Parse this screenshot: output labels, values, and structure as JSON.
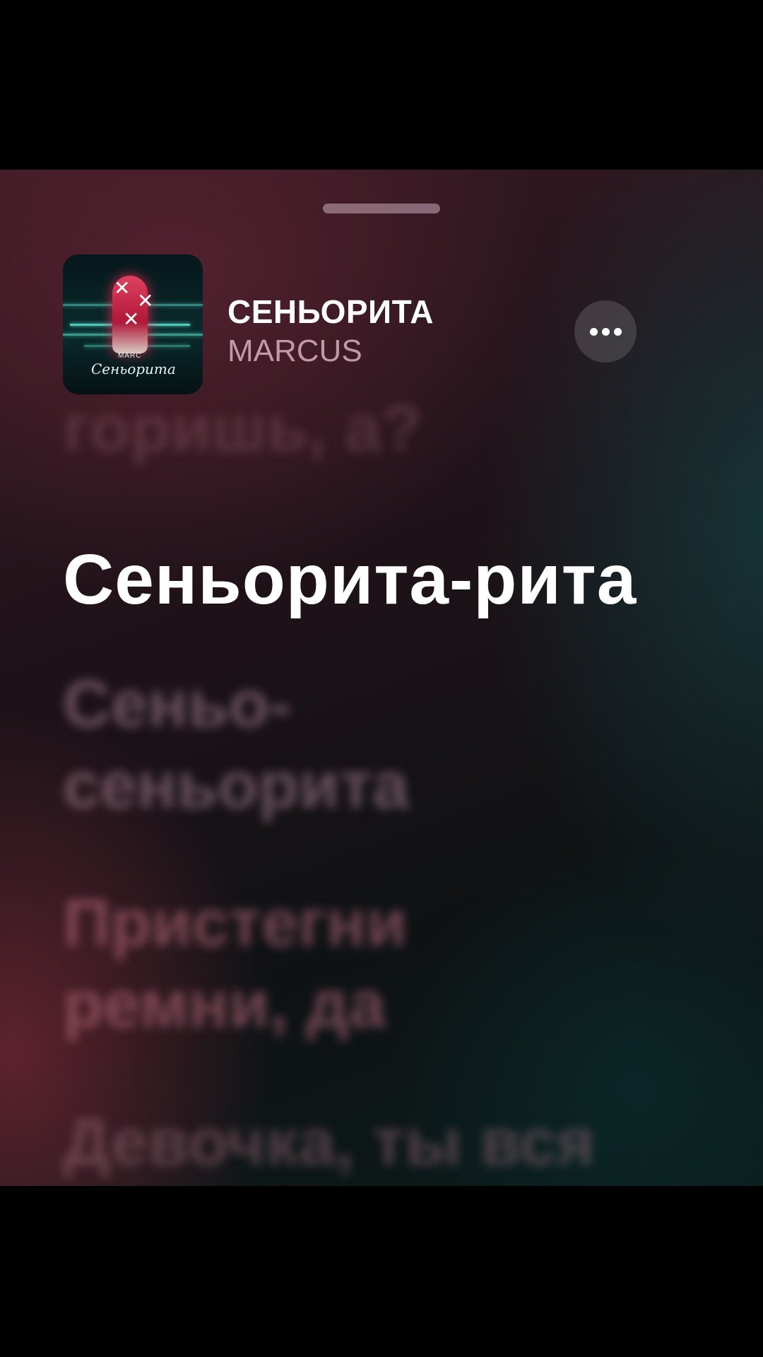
{
  "now_playing": {
    "title": "СЕНЬОРИТА",
    "artist": "MARCUS",
    "artwork_caption": "Сеньорита",
    "artwork_small_text": "MARC"
  },
  "lyrics": {
    "previous_line": "горишь, а?",
    "current_line": "Сеньорита-рита",
    "upcoming": [
      "Сеньо-",
      "сеньорита",
      "Пристегни",
      "ремни, да",
      "Девочка, ты вся"
    ]
  },
  "controls": {
    "more_icon": "ellipsis-icon"
  },
  "colors": {
    "accent": "#ffffff",
    "artist": "#d7afbe"
  }
}
